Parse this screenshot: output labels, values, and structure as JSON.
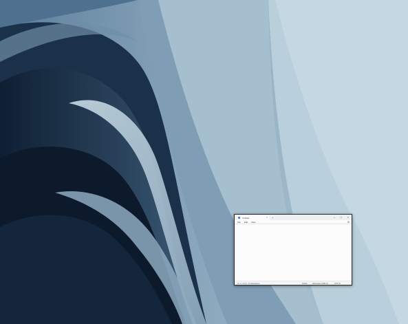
{
  "desktop": {
    "wallpaper": "bloom-wallpaper",
    "accent": "#1e3550"
  },
  "notepad": {
    "tab_title": "Untitled",
    "menu": [
      "File",
      "Edit",
      "View"
    ],
    "content": "",
    "status": {
      "position": "Ln 1, Col 1",
      "chars": "0 characters",
      "zoom": "100%",
      "line_ending": "Windows (CRLF)",
      "encoding": "UTF-8"
    }
  }
}
